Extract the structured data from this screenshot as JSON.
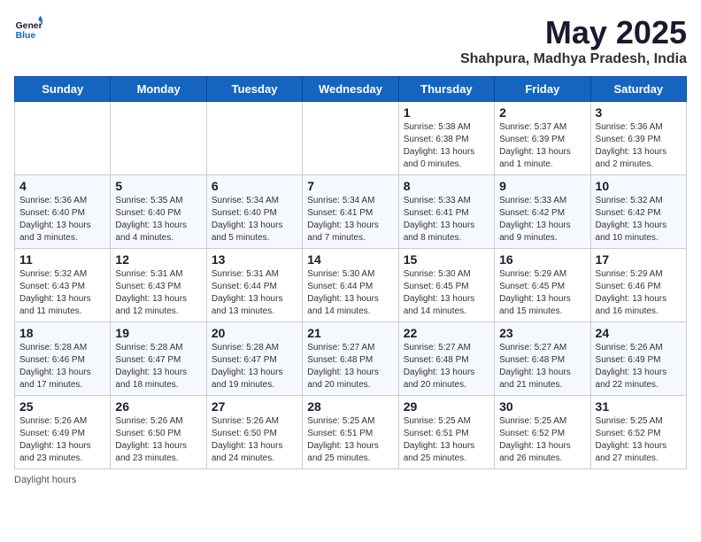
{
  "header": {
    "logo_general": "General",
    "logo_blue": "Blue",
    "month_year": "May 2025",
    "location": "Shahpura, Madhya Pradesh, India"
  },
  "days_of_week": [
    "Sunday",
    "Monday",
    "Tuesday",
    "Wednesday",
    "Thursday",
    "Friday",
    "Saturday"
  ],
  "weeks": [
    [
      {
        "date": "",
        "info": ""
      },
      {
        "date": "",
        "info": ""
      },
      {
        "date": "",
        "info": ""
      },
      {
        "date": "",
        "info": ""
      },
      {
        "date": "1",
        "info": "Sunrise: 5:38 AM\nSunset: 6:38 PM\nDaylight: 13 hours and 0 minutes."
      },
      {
        "date": "2",
        "info": "Sunrise: 5:37 AM\nSunset: 6:39 PM\nDaylight: 13 hours and 1 minute."
      },
      {
        "date": "3",
        "info": "Sunrise: 5:36 AM\nSunset: 6:39 PM\nDaylight: 13 hours and 2 minutes."
      }
    ],
    [
      {
        "date": "4",
        "info": "Sunrise: 5:36 AM\nSunset: 6:40 PM\nDaylight: 13 hours and 3 minutes."
      },
      {
        "date": "5",
        "info": "Sunrise: 5:35 AM\nSunset: 6:40 PM\nDaylight: 13 hours and 4 minutes."
      },
      {
        "date": "6",
        "info": "Sunrise: 5:34 AM\nSunset: 6:40 PM\nDaylight: 13 hours and 5 minutes."
      },
      {
        "date": "7",
        "info": "Sunrise: 5:34 AM\nSunset: 6:41 PM\nDaylight: 13 hours and 7 minutes."
      },
      {
        "date": "8",
        "info": "Sunrise: 5:33 AM\nSunset: 6:41 PM\nDaylight: 13 hours and 8 minutes."
      },
      {
        "date": "9",
        "info": "Sunrise: 5:33 AM\nSunset: 6:42 PM\nDaylight: 13 hours and 9 minutes."
      },
      {
        "date": "10",
        "info": "Sunrise: 5:32 AM\nSunset: 6:42 PM\nDaylight: 13 hours and 10 minutes."
      }
    ],
    [
      {
        "date": "11",
        "info": "Sunrise: 5:32 AM\nSunset: 6:43 PM\nDaylight: 13 hours and 11 minutes."
      },
      {
        "date": "12",
        "info": "Sunrise: 5:31 AM\nSunset: 6:43 PM\nDaylight: 13 hours and 12 minutes."
      },
      {
        "date": "13",
        "info": "Sunrise: 5:31 AM\nSunset: 6:44 PM\nDaylight: 13 hours and 13 minutes."
      },
      {
        "date": "14",
        "info": "Sunrise: 5:30 AM\nSunset: 6:44 PM\nDaylight: 13 hours and 14 minutes."
      },
      {
        "date": "15",
        "info": "Sunrise: 5:30 AM\nSunset: 6:45 PM\nDaylight: 13 hours and 14 minutes."
      },
      {
        "date": "16",
        "info": "Sunrise: 5:29 AM\nSunset: 6:45 PM\nDaylight: 13 hours and 15 minutes."
      },
      {
        "date": "17",
        "info": "Sunrise: 5:29 AM\nSunset: 6:46 PM\nDaylight: 13 hours and 16 minutes."
      }
    ],
    [
      {
        "date": "18",
        "info": "Sunrise: 5:28 AM\nSunset: 6:46 PM\nDaylight: 13 hours and 17 minutes."
      },
      {
        "date": "19",
        "info": "Sunrise: 5:28 AM\nSunset: 6:47 PM\nDaylight: 13 hours and 18 minutes."
      },
      {
        "date": "20",
        "info": "Sunrise: 5:28 AM\nSunset: 6:47 PM\nDaylight: 13 hours and 19 minutes."
      },
      {
        "date": "21",
        "info": "Sunrise: 5:27 AM\nSunset: 6:48 PM\nDaylight: 13 hours and 20 minutes."
      },
      {
        "date": "22",
        "info": "Sunrise: 5:27 AM\nSunset: 6:48 PM\nDaylight: 13 hours and 20 minutes."
      },
      {
        "date": "23",
        "info": "Sunrise: 5:27 AM\nSunset: 6:48 PM\nDaylight: 13 hours and 21 minutes."
      },
      {
        "date": "24",
        "info": "Sunrise: 5:26 AM\nSunset: 6:49 PM\nDaylight: 13 hours and 22 minutes."
      }
    ],
    [
      {
        "date": "25",
        "info": "Sunrise: 5:26 AM\nSunset: 6:49 PM\nDaylight: 13 hours and 23 minutes."
      },
      {
        "date": "26",
        "info": "Sunrise: 5:26 AM\nSunset: 6:50 PM\nDaylight: 13 hours and 23 minutes."
      },
      {
        "date": "27",
        "info": "Sunrise: 5:26 AM\nSunset: 6:50 PM\nDaylight: 13 hours and 24 minutes."
      },
      {
        "date": "28",
        "info": "Sunrise: 5:25 AM\nSunset: 6:51 PM\nDaylight: 13 hours and 25 minutes."
      },
      {
        "date": "29",
        "info": "Sunrise: 5:25 AM\nSunset: 6:51 PM\nDaylight: 13 hours and 25 minutes."
      },
      {
        "date": "30",
        "info": "Sunrise: 5:25 AM\nSunset: 6:52 PM\nDaylight: 13 hours and 26 minutes."
      },
      {
        "date": "31",
        "info": "Sunrise: 5:25 AM\nSunset: 6:52 PM\nDaylight: 13 hours and 27 minutes."
      }
    ]
  ],
  "footer": {
    "daylight_hours": "Daylight hours"
  }
}
